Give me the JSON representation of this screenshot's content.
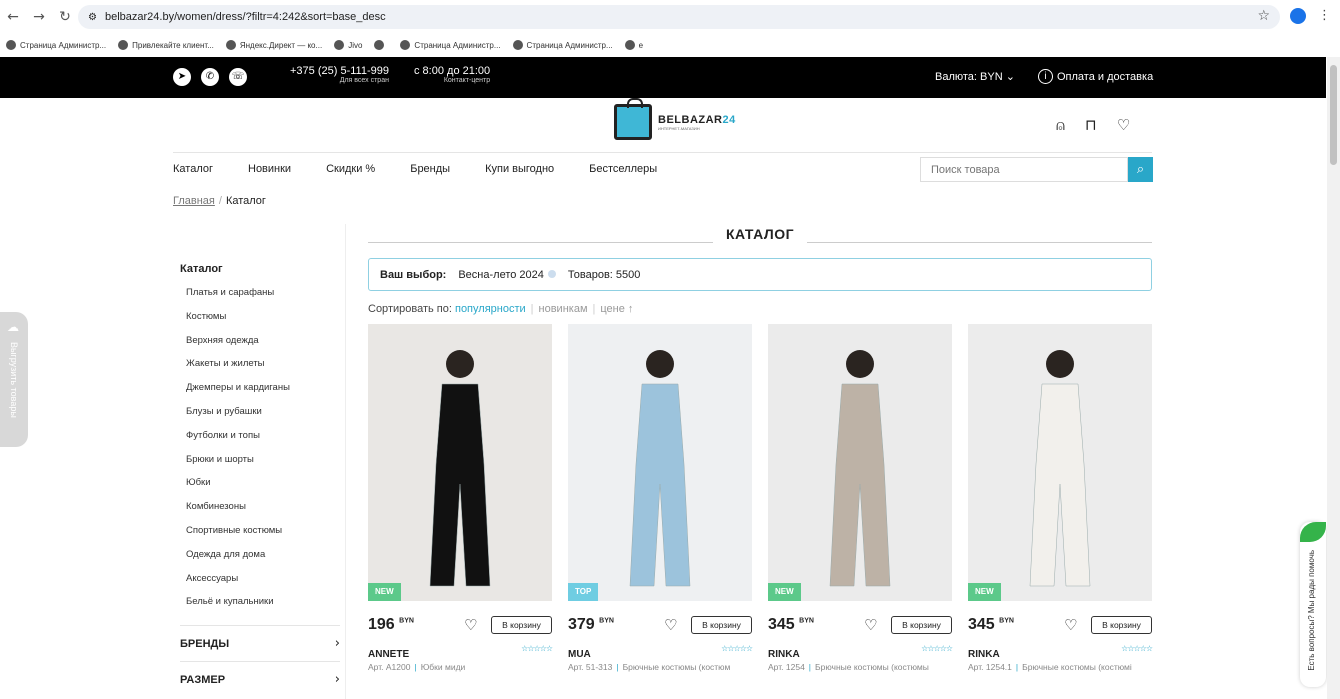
{
  "browser": {
    "url": "belbazar24.by/women/dress/?filtr=4:242&sort=base_desc",
    "back": "←",
    "forward": "→",
    "reload": "↻",
    "star": "☆",
    "menu": "⋮",
    "bookmarks": [
      "Страница Администр...",
      "Привлекайте клиент...",
      "Яндекс.Директ — ко...",
      "Jivo",
      "",
      "Страница Администр...",
      "Страница Администр...",
      "е"
    ]
  },
  "topbar": {
    "phone": "+375 (25) 5-111-999",
    "phone_note": "Для всех стран",
    "hours": "с 8:00 до 21:00",
    "hours_note": "Контакт-центр",
    "currency": "Валюта: BYN ⌄",
    "delivery": "Оплата и доставка",
    "info_glyph": "i"
  },
  "logo": {
    "name": "BELBAZAR",
    "num": "24",
    "sub": "ИНТЕРНЕТ-МАГАЗИН"
  },
  "nav": [
    "Каталог",
    "Новинки",
    "Скидки %",
    "Бренды",
    "Купи выгодно",
    "Бестселлеры"
  ],
  "search": {
    "placeholder": "Поиск товара"
  },
  "breadcrumb": {
    "home": "Главная",
    "sep": "/",
    "current": "Каталог"
  },
  "sidebar": {
    "title": "Каталог",
    "items": [
      "Платья и сарафаны",
      "Костюмы",
      "Верхняя одежда",
      "Жакеты и жилеты",
      "Джемперы и кардиганы",
      "Блузы и рубашки",
      "Футболки и топы",
      "Брюки и шорты",
      "Юбки",
      "Комбинезоны",
      "Спортивные костюмы",
      "Одежда для дома",
      "Аксессуары",
      "Бельё и купальники"
    ],
    "filters": [
      "БРЕНДЫ",
      "РАЗМЕР"
    ]
  },
  "catalog": {
    "title": "КАТАЛОГ",
    "choice_label": "Ваш выбор:",
    "choice_value": "Весна-лето 2024",
    "count": "Товаров: 5500",
    "sort_label": "Сортировать по:",
    "sort_options": [
      "популярности",
      "новинкам",
      "цене ↑"
    ]
  },
  "currency_sup": "BYN",
  "cart_label": "В корзину",
  "stars": "☆☆☆☆☆",
  "products": [
    {
      "badge": "NEW",
      "badge_color": "#5cc98a",
      "price": "196",
      "brand": "ANNETE",
      "art": "Арт. А1200",
      "cat": "Юбки миди",
      "dress_color": "#111111",
      "bg": "#e9e7e4"
    },
    {
      "badge": "TOP",
      "badge_color": "#6fcde2",
      "price": "379",
      "brand": "MUA",
      "art": "Арт. 51-313",
      "cat": "Брючные костюмы (костюм",
      "dress_color": "#9cc3dc",
      "bg": "#eef0f2"
    },
    {
      "badge": "NEW",
      "badge_color": "#5cc98a",
      "price": "345",
      "brand": "RINKA",
      "art": "Арт. 1254",
      "cat": "Брючные костюмы (костюмы",
      "dress_color": "#bdb2a6",
      "bg": "#ebebeb"
    },
    {
      "badge": "NEW",
      "badge_color": "#5cc98a",
      "price": "345",
      "brand": "RINKA",
      "art": "Арт. 1254.1",
      "cat": "Брючные костюмы (костюмі",
      "dress_color": "#f2f0ec",
      "bg": "#ececec"
    }
  ],
  "widgets": {
    "upload": "Выгрузить товары",
    "chat": "Есть вопросы? Мы рады помочь"
  }
}
